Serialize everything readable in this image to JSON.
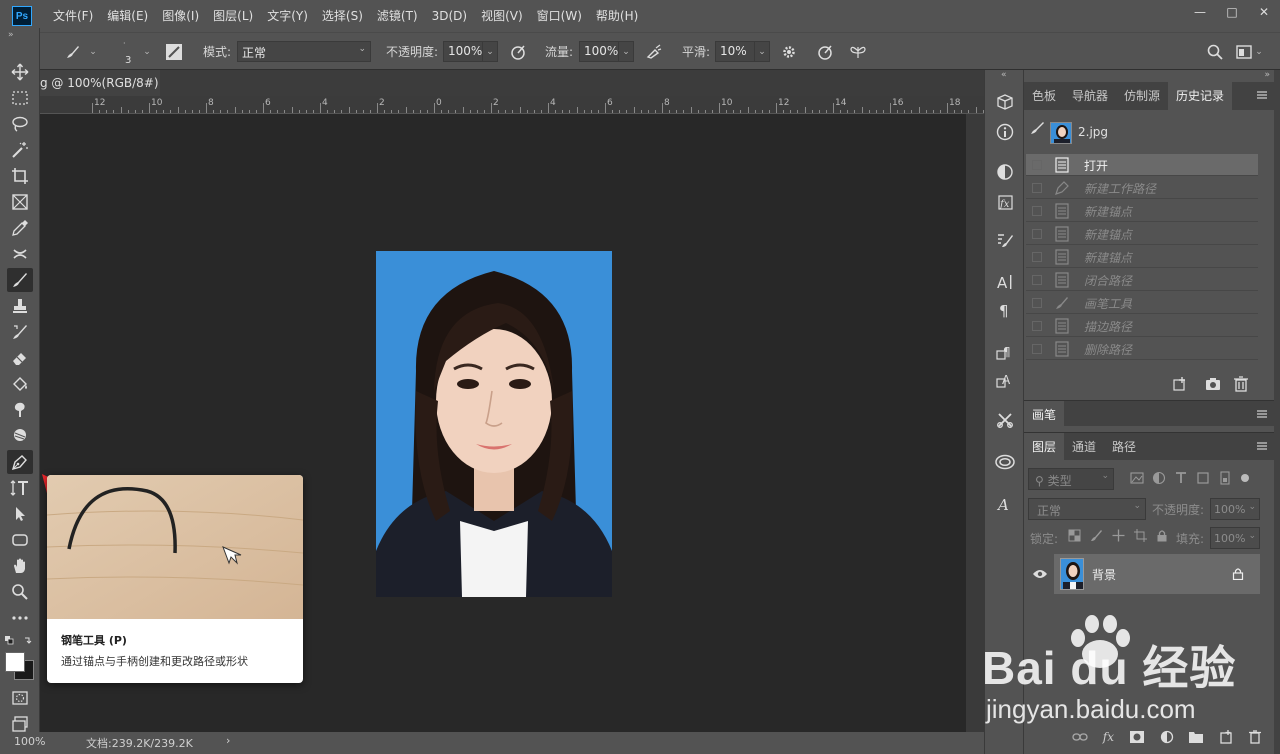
{
  "menubar": {
    "logo": "Ps",
    "items": [
      "文件(F)",
      "编辑(E)",
      "图像(I)",
      "图层(L)",
      "文字(Y)",
      "选择(S)",
      "滤镜(T)",
      "3D(D)",
      "视图(V)",
      "窗口(W)",
      "帮助(H)"
    ],
    "window_controls": [
      "—",
      "□",
      "✕"
    ]
  },
  "options": {
    "brush_size": "3",
    "mode_label": "模式:",
    "mode_value": "正常",
    "opacity_label": "不透明度:",
    "opacity_value": "100%",
    "flow_label": "流量:",
    "flow_value": "100%",
    "smooth_label": "平滑:",
    "smooth_value": "10%"
  },
  "document": {
    "tab_title": "g @ 100%(RGB/8#) *",
    "tab_close": "×",
    "ruler_labels": [
      "12",
      "10",
      "8",
      "6",
      "4",
      "2",
      "0",
      "2",
      "4",
      "6",
      "8",
      "10",
      "12",
      "14",
      "16",
      "18",
      "20"
    ]
  },
  "status": {
    "zoom": "100%",
    "doc_info": "文档:239.2K/239.2K",
    "arrow": "›"
  },
  "tooltip": {
    "title": "钢笔工具 (P)",
    "description": "通过锚点与手柄创建和更改路径或形状"
  },
  "history_panel": {
    "tabs": [
      "色板",
      "导航器",
      "仿制源",
      "历史记录"
    ],
    "active_tab": "历史记录",
    "snapshot_name": "2.jpg",
    "items": [
      {
        "label": "打开",
        "current": true
      },
      {
        "label": "新建工作路径",
        "current": false
      },
      {
        "label": "新建锚点",
        "current": false
      },
      {
        "label": "新建锚点",
        "current": false
      },
      {
        "label": "新建锚点",
        "current": false
      },
      {
        "label": "闭合路径",
        "current": false
      },
      {
        "label": "画笔工具",
        "current": false
      },
      {
        "label": "描边路径",
        "current": false
      },
      {
        "label": "删除路径",
        "current": false
      }
    ]
  },
  "brush_panel": {
    "tab": "画笔"
  },
  "layers_panel": {
    "tabs": [
      "图层",
      "通道",
      "路径"
    ],
    "active_tab": "图层",
    "filter_placeholder": "类型",
    "blend_mode": "正常",
    "opacity_label": "不透明度:",
    "opacity_value": "100%",
    "lock_label": "锁定:",
    "fill_label": "填充:",
    "fill_value": "100%",
    "layers": [
      {
        "name": "背景",
        "visible": true,
        "locked": true
      }
    ],
    "footer_fx": "fx"
  },
  "watermark": {
    "brand": "Bai du 经验",
    "url": "jingyan.baidu.com"
  },
  "colors": {
    "ui_bg": "#535353",
    "canvas_bg": "#282828",
    "photo_bg": "#3a8fd8",
    "arrow": "#e8252a"
  }
}
